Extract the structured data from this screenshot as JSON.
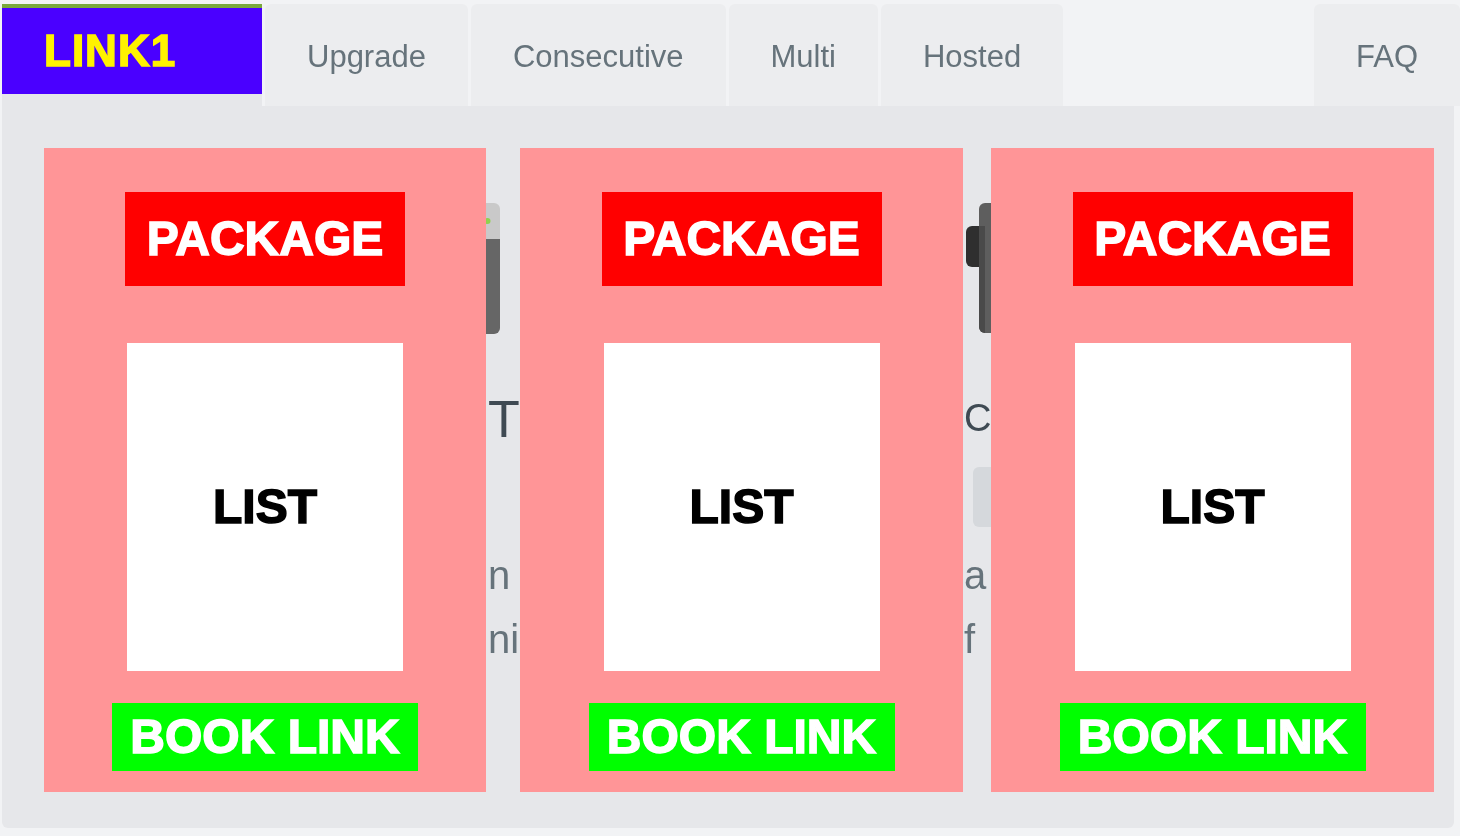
{
  "nav": {
    "items": [
      {
        "kind": "logo",
        "label": "LINK1",
        "selected": true
      },
      {
        "kind": "tab",
        "label": "Upgrade",
        "selected": false
      },
      {
        "kind": "tab",
        "label": "Consecutive",
        "selected": false
      },
      {
        "kind": "tab",
        "label": "Multi",
        "selected": false
      },
      {
        "kind": "tab",
        "label": "Hosted",
        "selected": false
      }
    ],
    "right_items": [
      {
        "kind": "tab",
        "label": "FAQ",
        "selected": false
      }
    ]
  },
  "cards": [
    {
      "banner": "PACKAGE",
      "list": "LIST",
      "link": "BOOK LINK"
    },
    {
      "banner": "PACKAGE",
      "list": "LIST",
      "link": "BOOK LINK"
    },
    {
      "banner": "PACKAGE",
      "list": "LIST",
      "link": "BOOK LINK"
    }
  ],
  "background_gaps": [
    {
      "kind": "phone",
      "heading": "T",
      "has_button": false,
      "lines": [
        "n",
        "ni"
      ]
    },
    {
      "kind": "device",
      "heading": "C",
      "has_button": true,
      "lines": [
        "a",
        "f"
      ]
    }
  ]
}
